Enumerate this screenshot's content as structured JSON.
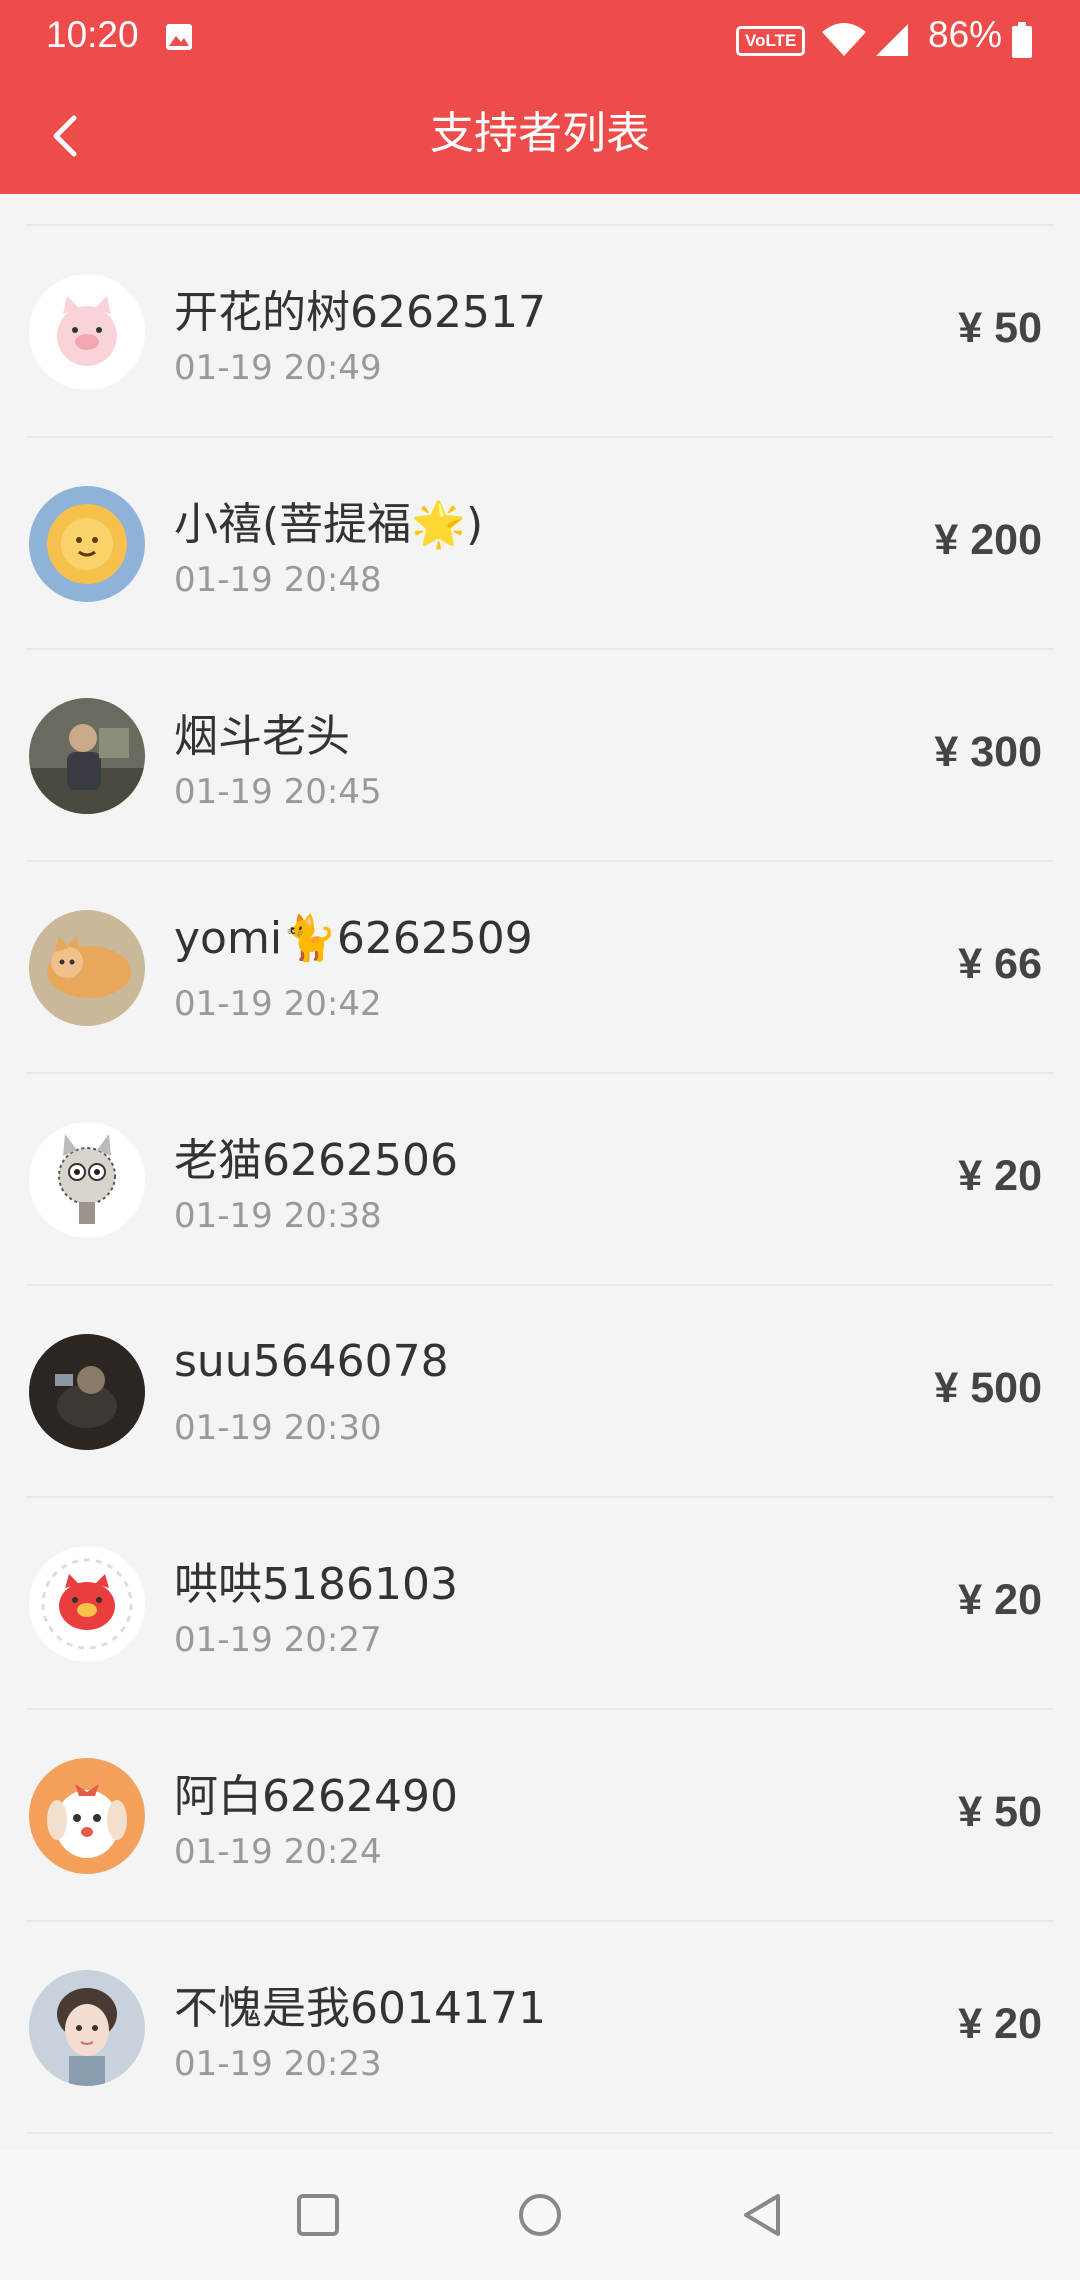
{
  "status_bar": {
    "time": "10:20",
    "volte": "VoLTE",
    "battery": "86%",
    "icons": [
      "photo-icon",
      "wifi-icon",
      "signal-icon",
      "battery-icon"
    ]
  },
  "header": {
    "title": "支持者列表",
    "back_icon": "chevron-left-icon",
    "background": "#ee4b4b"
  },
  "supporters": [
    {
      "name": "开花的树6262517",
      "time": "01-19 20:49",
      "amount": "¥ 50"
    },
    {
      "name": "小禧(菩提福🌟)",
      "time": "01-19 20:48",
      "amount": "¥ 200"
    },
    {
      "name": "烟斗老头",
      "time": "01-19 20:45",
      "amount": "¥ 300"
    },
    {
      "name": "yomi🐈6262509",
      "time": "01-19 20:42",
      "amount": "¥ 66"
    },
    {
      "name": "老猫6262506",
      "time": "01-19 20:38",
      "amount": "¥ 20"
    },
    {
      "name": "suu5646078",
      "time": "01-19 20:30",
      "amount": "¥ 500"
    },
    {
      "name": "哄哄5186103",
      "time": "01-19 20:27",
      "amount": "¥ 20"
    },
    {
      "name": "阿白6262490",
      "time": "01-19 20:24",
      "amount": "¥ 50"
    },
    {
      "name": "不愧是我6014171",
      "time": "01-19 20:23",
      "amount": "¥ 20"
    }
  ],
  "system_nav": {
    "icons": [
      "recents-square-icon",
      "home-circle-icon",
      "back-triangle-icon"
    ]
  }
}
